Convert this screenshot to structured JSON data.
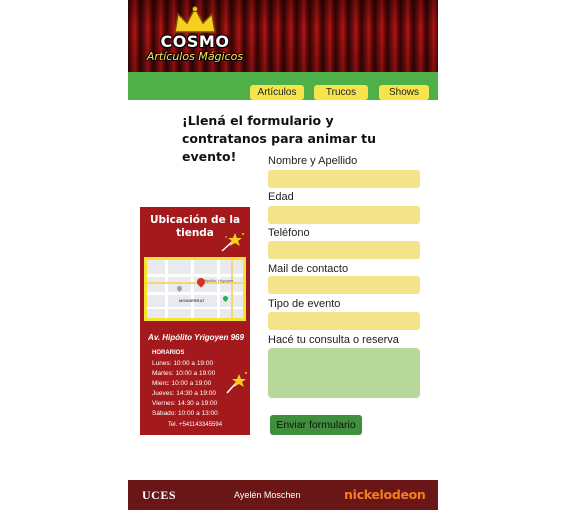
{
  "header": {
    "logo_title": "COSMO",
    "logo_subtitle": "Artículos Mágicos"
  },
  "nav": {
    "items": [
      {
        "label": "Artículos"
      },
      {
        "label": "Trucos"
      },
      {
        "label": "Shows"
      }
    ]
  },
  "heading": "¡Llená el formulario y contratanos para animar tu evento!",
  "store": {
    "title": "Ubicación de la tienda",
    "address": "Av. Hipólito Yrigoyen 969",
    "hours_title": "HORARIOS",
    "hours": [
      "Lunes: 10:00 a 19:00",
      "Martes: 10:00 a 19:00",
      "Mierc: 10:00 a 19:00",
      "Jueves: 14:30 a 19:00",
      "Viernes: 14:30 a 19:00",
      "Sábado: 10:00 a 13:00"
    ],
    "phone": "Tel. +541143345594",
    "map_labels": [
      "MONSERRAT",
      "Hipólito Yrigoyen"
    ]
  },
  "form": {
    "fields": [
      {
        "label": "Nombre y Apellido",
        "value": ""
      },
      {
        "label": "Edad",
        "value": ""
      },
      {
        "label": "Teléfono",
        "value": ""
      },
      {
        "label": "Mail de contacto",
        "value": ""
      },
      {
        "label": "Tipo de evento",
        "value": ""
      }
    ],
    "message": {
      "label": "Hacé tu consulta o reserva",
      "value": ""
    },
    "submit_label": "Enviar formulario"
  },
  "footer": {
    "left_logo": "UCES",
    "author": "Ayelén Moschen",
    "right_logo": "nickelodeon"
  },
  "colors": {
    "curtain": "#7d0d0d",
    "nav_green": "#4fb04a",
    "nav_button": "#f6e44a",
    "card_red": "#a4191b",
    "input_yellow": "#f3e48a",
    "textarea_green": "#b8d89a",
    "submit_green": "#3f8f3c",
    "footer": "#6a1616",
    "nick_orange": "#f57d1f"
  },
  "icons": [
    "crown-icon",
    "magic-wand-icon",
    "map-pin-icon"
  ]
}
